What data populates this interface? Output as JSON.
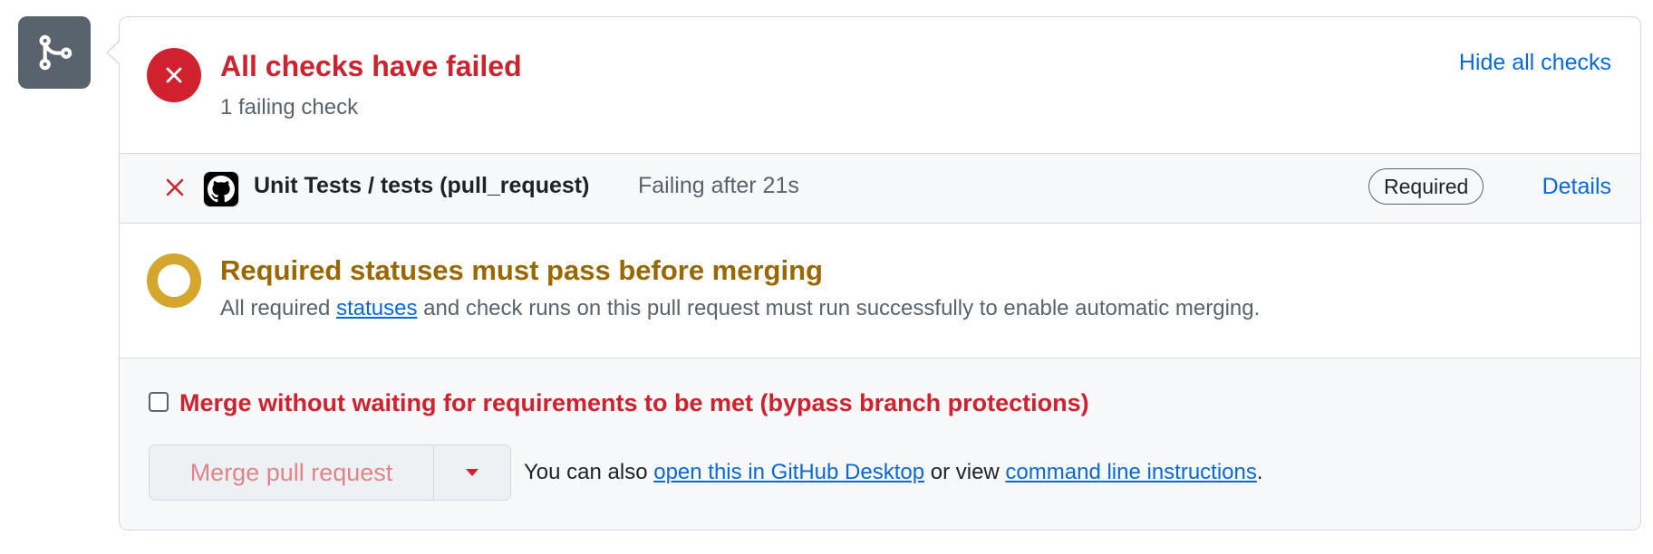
{
  "colors": {
    "danger": "#cf222e",
    "attention": "#9a6700",
    "attention_ring": "#d4a72c",
    "link": "#0969da",
    "muted": "#59636e",
    "canvas_subtle": "#f6f8fa"
  },
  "icons": {
    "merge": "git-merge-icon",
    "fail": "x-circle-fill-icon",
    "check_fail": "x-icon",
    "github": "github-mark-icon",
    "pending": "dot-ring-icon",
    "dropdown": "triangle-down-icon"
  },
  "checks_summary": {
    "title": "All checks have failed",
    "subtitle": "1 failing check",
    "hide_label": "Hide all checks"
  },
  "check_row": {
    "name": "Unit Tests / tests (pull_request)",
    "status": "Failing after 21s",
    "badge": "Required",
    "details_label": "Details"
  },
  "required_status": {
    "title": "Required statuses must pass before merging",
    "desc_before": "All required ",
    "desc_link": "statuses",
    "desc_after": " and check runs on this pull request must run successfully to enable automatic merging."
  },
  "merge": {
    "bypass_label": "Merge without waiting for requirements to be met (bypass branch protections)",
    "bypass_checked": false,
    "button_label": "Merge pull request",
    "also_prefix": "You can also ",
    "desktop_link": "open this in GitHub Desktop",
    "or_view": " or view ",
    "cli_link": "command line instructions",
    "suffix": "."
  }
}
